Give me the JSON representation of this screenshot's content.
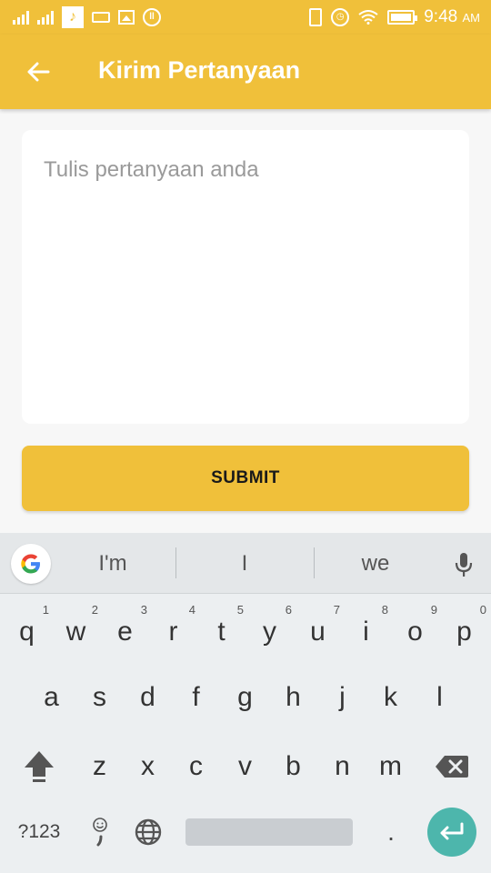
{
  "status_bar": {
    "time": "9:48",
    "ampm": "AM",
    "icons": [
      "signal-icon",
      "signal-icon",
      "music-note-icon",
      "keyboard-icon",
      "image-icon",
      "alarm-icon",
      "vibrate-icon",
      "alarm-clock-icon",
      "wifi-icon",
      "battery-icon"
    ]
  },
  "app_bar": {
    "title": "Kirim Pertanyaan",
    "back_icon": "arrow-left-icon",
    "color": "#f0c03a"
  },
  "form": {
    "question_placeholder": "Tulis pertanyaan anda",
    "question_value": "",
    "submit_label": "SUBMIT"
  },
  "keyboard": {
    "suggestions": [
      "I'm",
      "I",
      "we"
    ],
    "row1": [
      {
        "key": "q",
        "hint": "1"
      },
      {
        "key": "w",
        "hint": "2"
      },
      {
        "key": "e",
        "hint": "3"
      },
      {
        "key": "r",
        "hint": "4"
      },
      {
        "key": "t",
        "hint": "5"
      },
      {
        "key": "y",
        "hint": "6"
      },
      {
        "key": "u",
        "hint": "7"
      },
      {
        "key": "i",
        "hint": "8"
      },
      {
        "key": "o",
        "hint": "9"
      },
      {
        "key": "p",
        "hint": "0"
      }
    ],
    "row2": [
      "a",
      "s",
      "d",
      "f",
      "g",
      "h",
      "j",
      "k",
      "l"
    ],
    "row3": [
      "z",
      "x",
      "c",
      "v",
      "b",
      "n",
      "m"
    ],
    "symbols_label": "?123",
    "period_label": ".",
    "enter_color": "#4db6ac"
  }
}
